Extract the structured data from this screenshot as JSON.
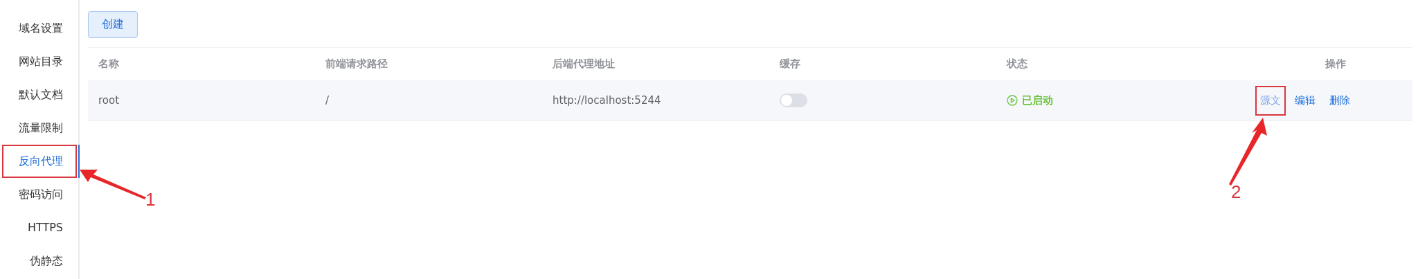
{
  "sidebar": {
    "items": [
      {
        "label": "域名设置",
        "selected": false
      },
      {
        "label": "网站目录",
        "selected": false
      },
      {
        "label": "默认文档",
        "selected": false
      },
      {
        "label": "流量限制",
        "selected": false
      },
      {
        "label": "反向代理",
        "selected": true,
        "callout": "1"
      },
      {
        "label": "密码访问",
        "selected": false
      },
      {
        "label": "HTTPS",
        "selected": false
      },
      {
        "label": "伪静态",
        "selected": false
      }
    ]
  },
  "toolbar": {
    "create_button": "创建"
  },
  "table": {
    "columns": [
      "名称",
      "前端请求路径",
      "后端代理地址",
      "缓存",
      "状态",
      "操作"
    ],
    "rows": [
      {
        "name": "root",
        "path": "/",
        "backend": "http://localhost:5244",
        "cache_on": false,
        "status": "已启动",
        "running": true,
        "actions": [
          {
            "label": "源文",
            "hovered": true,
            "callout": "2"
          },
          {
            "label": "编辑",
            "hovered": false
          },
          {
            "label": "删除",
            "hovered": false
          }
        ]
      }
    ]
  }
}
